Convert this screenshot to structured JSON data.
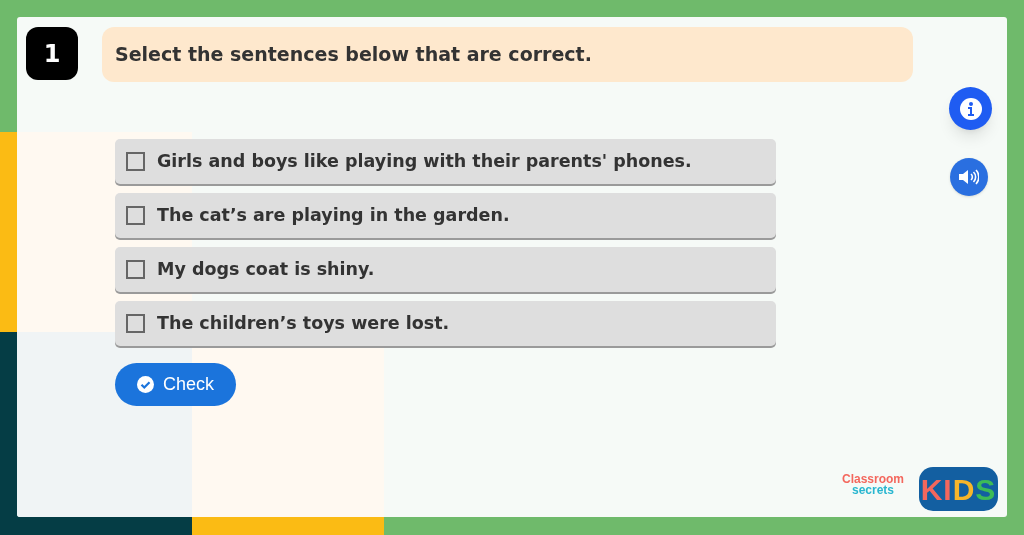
{
  "question": {
    "number": "1",
    "prompt": "Select the sentences below that are correct."
  },
  "options": [
    {
      "text": "Girls and boys like playing with their parents' phones.",
      "checked": false
    },
    {
      "text": "The cat’s are playing in the garden.",
      "checked": false
    },
    {
      "text": "My dogs coat is shiny.",
      "checked": false
    },
    {
      "text": "The children’s toys were lost.",
      "checked": false
    }
  ],
  "check_button": "Check",
  "logo": {
    "line_1": "Classroom",
    "line_2": "secrets",
    "badge": "KIDS"
  }
}
